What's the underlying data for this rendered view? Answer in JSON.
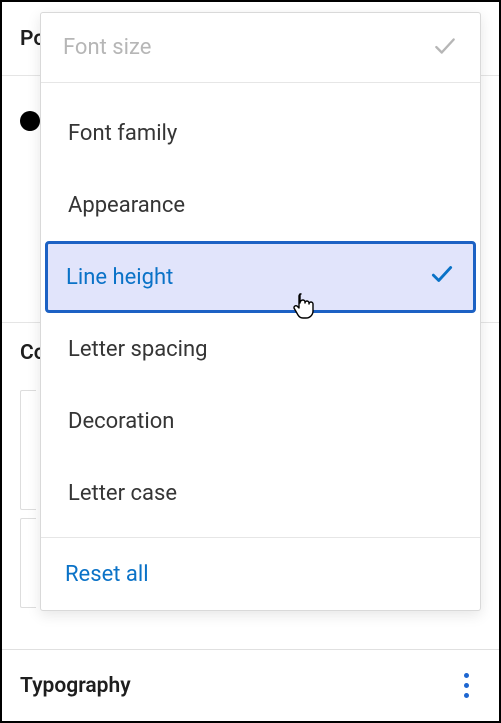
{
  "background": {
    "row1_partial": "Po",
    "row2_partial": "Co",
    "section_title": "Typography"
  },
  "popover": {
    "header_label": "Font size",
    "items": [
      {
        "label": "Font family",
        "selected": false
      },
      {
        "label": "Appearance",
        "selected": false
      },
      {
        "label": "Line height",
        "selected": true
      },
      {
        "label": "Letter spacing",
        "selected": false
      },
      {
        "label": "Decoration",
        "selected": false
      },
      {
        "label": "Letter case",
        "selected": false
      }
    ],
    "reset_label": "Reset all"
  },
  "colors": {
    "accent": "#0a72c7",
    "selected_bg": "#e1e4fb",
    "selected_border": "#1c61c4"
  }
}
